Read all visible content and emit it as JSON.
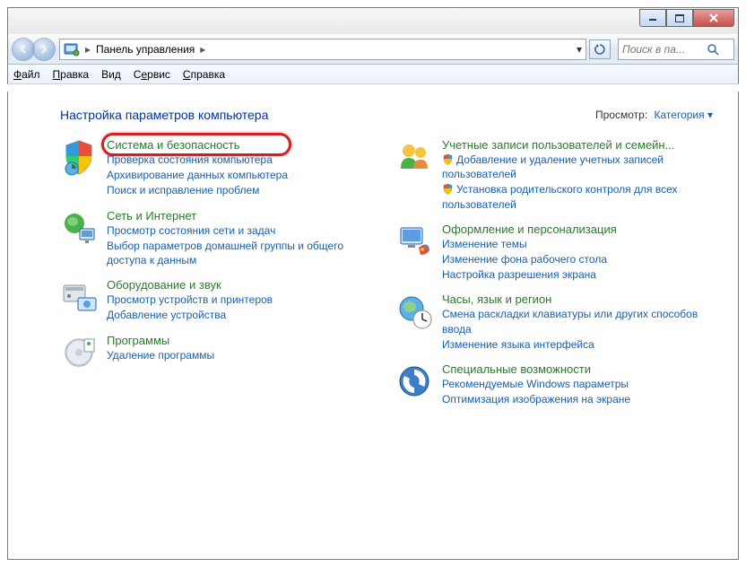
{
  "address": {
    "root": "Панель управления"
  },
  "search": {
    "placeholder": "Поиск в па..."
  },
  "menu": {
    "file": "Файл",
    "edit": "Правка",
    "view": "Вид",
    "tools": "Сервис",
    "help": "Справка"
  },
  "heading": "Настройка параметров компьютера",
  "viewby": {
    "label": "Просмотр:",
    "value": "Категория"
  },
  "left": [
    {
      "title": "Система и безопасность",
      "links": [
        "Проверка состояния компьютера",
        "Архивирование данных компьютера",
        "Поиск и исправление проблем"
      ]
    },
    {
      "title": "Сеть и Интернет",
      "links": [
        "Просмотр состояния сети и задач",
        "Выбор параметров домашней группы и общего доступа к данным"
      ]
    },
    {
      "title": "Оборудование и звук",
      "links": [
        "Просмотр устройств и принтеров",
        "Добавление устройства"
      ]
    },
    {
      "title": "Программы",
      "links": [
        "Удаление программы"
      ]
    }
  ],
  "right": [
    {
      "title": "Учетные записи пользователей и семейн...",
      "links": [
        {
          "text": "Добавление и удаление учетных записей пользователей",
          "shield": true
        },
        {
          "text": "Установка родительского контроля для всех пользователей",
          "shield": true
        }
      ]
    },
    {
      "title": "Оформление и персонализация",
      "links": [
        "Изменение темы",
        "Изменение фона рабочего стола",
        "Настройка разрешения экрана"
      ]
    },
    {
      "title": "Часы, язык и регион",
      "links": [
        "Смена раскладки клавиатуры или других способов ввода",
        "Изменение языка интерфейса"
      ]
    },
    {
      "title": "Специальные возможности",
      "links": [
        "Рекомендуемые Windows параметры",
        "Оптимизация изображения на экране"
      ]
    }
  ]
}
